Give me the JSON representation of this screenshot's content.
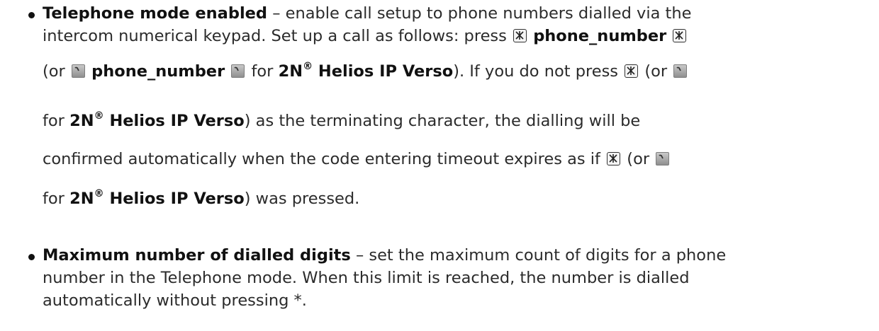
{
  "items": [
    {
      "term": "Telephone mode enabled",
      "seg": {
        "a": " – enable call setup to phone numbers dialled via the",
        "b": "intercom numerical keypad. Set up a call as follows: press",
        "pn1": "phone_number",
        "c": "(or",
        "pn2": "phone_number",
        "d": "for",
        "brand": "2N",
        "reg": "®",
        "product": "Helios IP Verso",
        "e": "). If you do not press",
        "f": "(or",
        "g": "for",
        "h": ") as the terminating character, the dialling will be",
        "i": "confirmed automatically when the code entering timeout expires as if",
        "j": "(or",
        "k": "for",
        "l": ") was pressed."
      }
    },
    {
      "term": "Maximum number of dialled digits",
      "line1": " – set the maximum count of digits for a phone",
      "line2": "number in the Telephone mode. When this limit is reached, the number is dialled",
      "line3": "automatically without pressing *."
    }
  ],
  "icons": {
    "star_key": "star-key-icon",
    "phone_key": "phone-key-icon"
  }
}
